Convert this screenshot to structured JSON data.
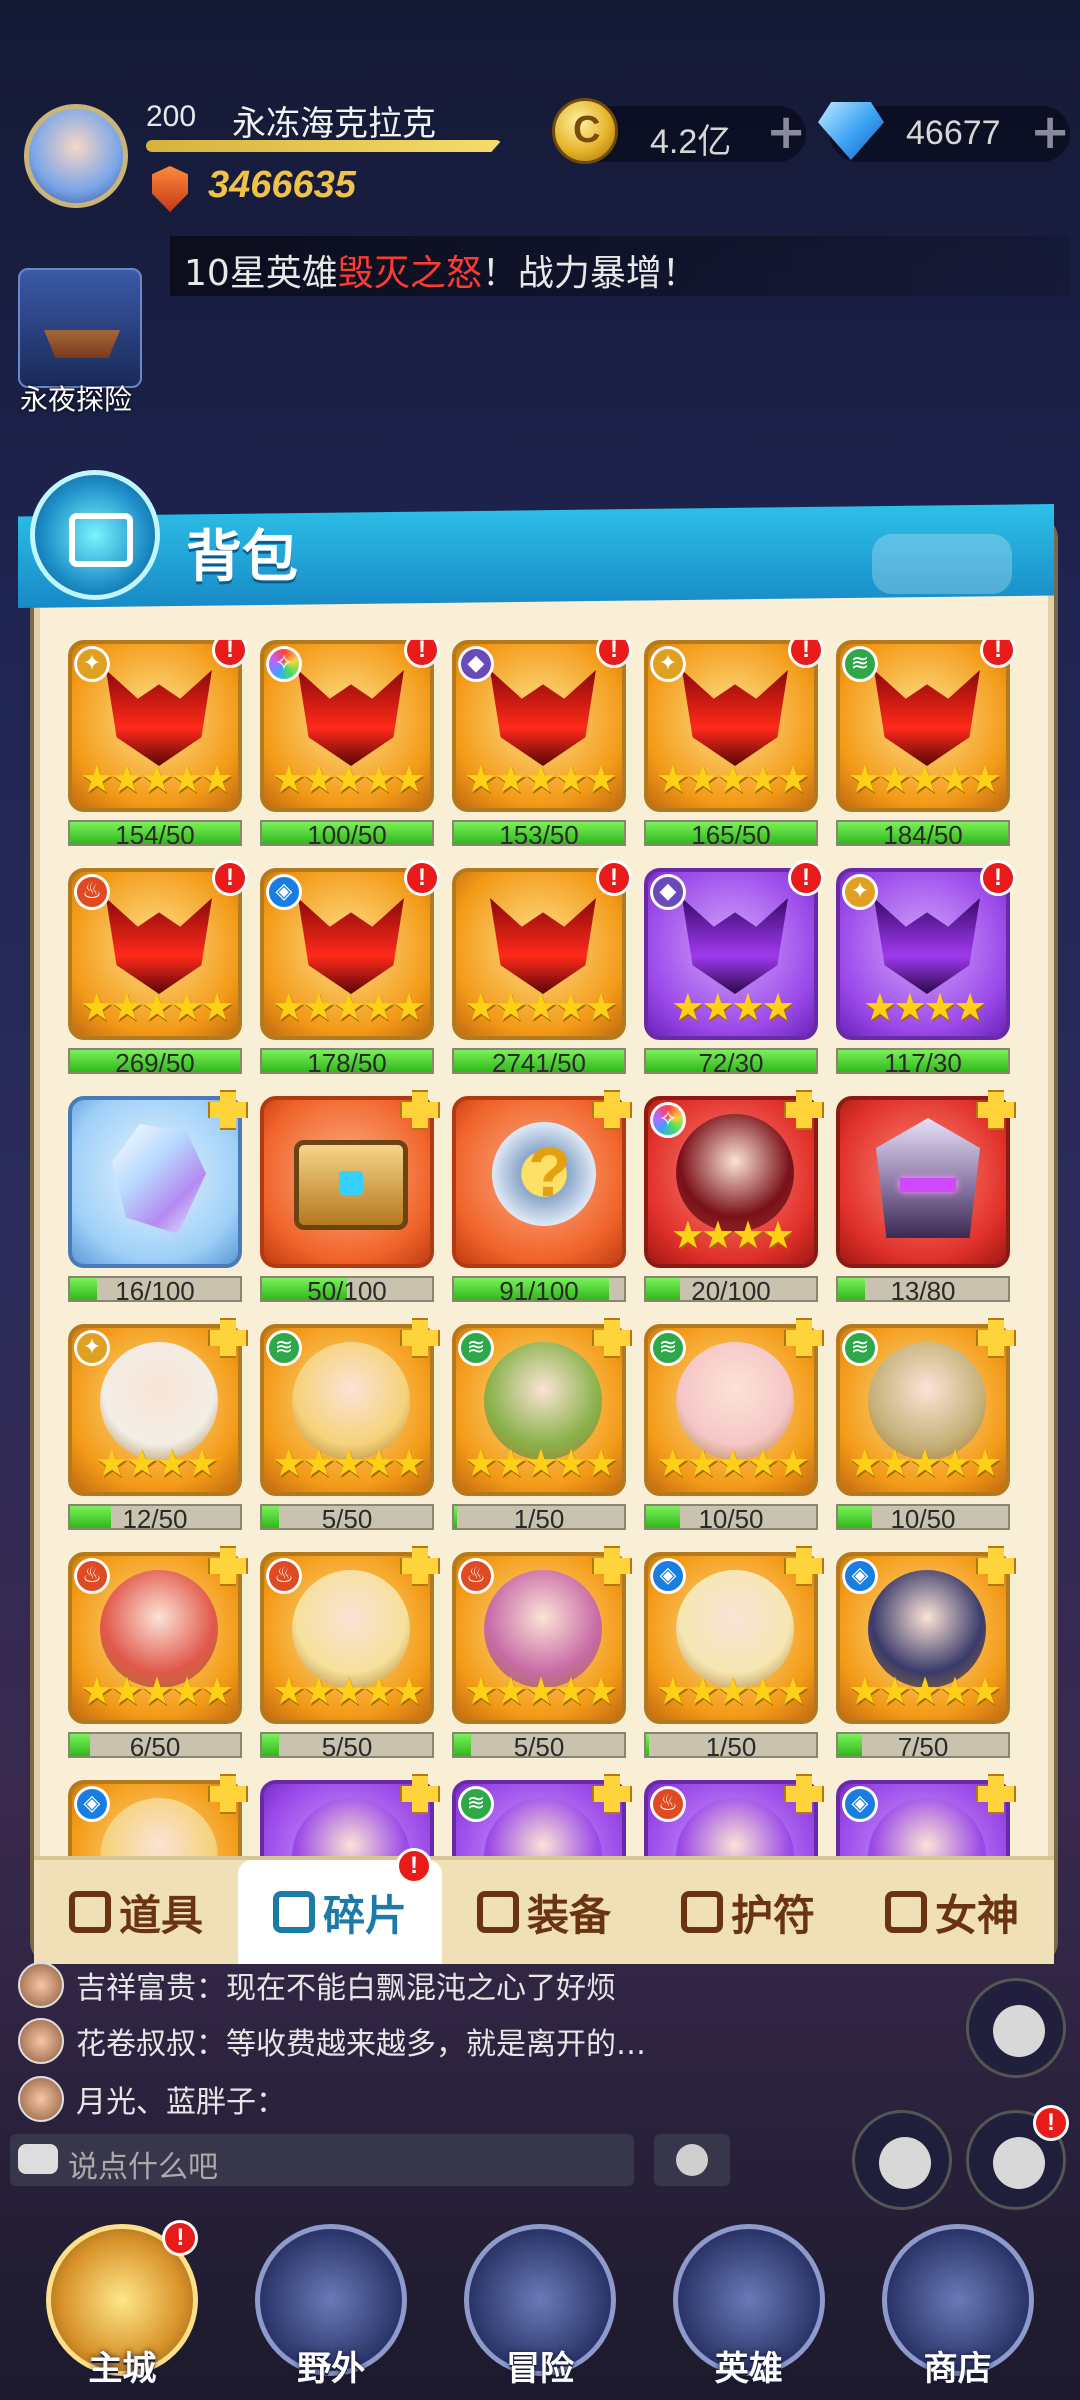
{
  "player": {
    "level": "200",
    "name": "永冻海克拉克",
    "power": "3466635"
  },
  "resources": {
    "gold": "4.2亿",
    "gems": "46677",
    "plus": "+"
  },
  "news": {
    "prefix": "10星英雄",
    "highlight": "毁灭之怒",
    "suffix": "！战力暴增！"
  },
  "side_event": {
    "label": "永夜探险"
  },
  "bag": {
    "title": "背包"
  },
  "items": [
    {
      "icon": "mask",
      "frame": "gold",
      "element": "light",
      "stars": "★★★★★",
      "progress": "154/50",
      "fill": 1.0,
      "badge": "alert"
    },
    {
      "icon": "mask",
      "frame": "gold",
      "element": "rainbow",
      "stars": "★★★★★",
      "progress": "100/50",
      "fill": 1.0,
      "badge": "alert"
    },
    {
      "icon": "mask",
      "frame": "gold",
      "element": "dark",
      "stars": "★★★★★",
      "progress": "153/50",
      "fill": 1.0,
      "badge": "alert"
    },
    {
      "icon": "mask",
      "frame": "gold",
      "element": "light",
      "stars": "★★★★★",
      "progress": "165/50",
      "fill": 1.0,
      "badge": "alert"
    },
    {
      "icon": "mask",
      "frame": "gold",
      "element": "nature",
      "stars": "★★★★★",
      "progress": "184/50",
      "fill": 1.0,
      "badge": "alert"
    },
    {
      "icon": "mask",
      "frame": "gold",
      "element": "fire",
      "stars": "★★★★★",
      "progress": "269/50",
      "fill": 1.0,
      "badge": "alert"
    },
    {
      "icon": "mask",
      "frame": "gold",
      "element": "water",
      "stars": "★★★★★",
      "progress": "178/50",
      "fill": 1.0,
      "badge": "alert"
    },
    {
      "icon": "mask",
      "frame": "gold",
      "element": "none",
      "stars": "★★★★★",
      "progress": "2741/50",
      "fill": 1.0,
      "badge": "alert"
    },
    {
      "icon": "mask-purple",
      "frame": "purple",
      "element": "dark",
      "stars": "★★★★",
      "progress": "72/30",
      "fill": 1.0,
      "badge": "alert"
    },
    {
      "icon": "mask-purple",
      "frame": "purple",
      "element": "light",
      "stars": "★★★★",
      "progress": "117/30",
      "fill": 1.0,
      "badge": "alert"
    },
    {
      "icon": "crystal",
      "frame": "blue",
      "element": "none",
      "stars": "",
      "progress": "16/100",
      "fill": 0.16,
      "badge": "piece"
    },
    {
      "icon": "chest",
      "frame": "orange",
      "element": "none",
      "stars": "",
      "progress": "50/100",
      "fill": 0.5,
      "badge": "piece"
    },
    {
      "icon": "qmark",
      "frame": "orange",
      "element": "none",
      "stars": "",
      "progress": "91/100",
      "fill": 0.91,
      "badge": "piece"
    },
    {
      "icon": "portrait",
      "frame": "red",
      "element": "rainbow",
      "stars": "★★★★",
      "progress": "20/100",
      "fill": 0.2,
      "badge": "piece",
      "color": "#7a1018"
    },
    {
      "icon": "helm",
      "frame": "red",
      "element": "none",
      "stars": "",
      "progress": "13/80",
      "fill": 0.16,
      "badge": "piece"
    },
    {
      "icon": "portrait",
      "frame": "gold",
      "element": "light",
      "stars": "★★★★",
      "progress": "12/50",
      "fill": 0.24,
      "badge": "piece",
      "color": "#f2eee6"
    },
    {
      "icon": "portrait",
      "frame": "gold",
      "element": "nature",
      "stars": "★★★★★",
      "progress": "5/50",
      "fill": 0.1,
      "badge": "piece",
      "color": "#f6d27a"
    },
    {
      "icon": "portrait",
      "frame": "gold",
      "element": "nature",
      "stars": "★★★★★",
      "progress": "1/50",
      "fill": 0.02,
      "badge": "piece",
      "color": "#8ab24a"
    },
    {
      "icon": "portrait",
      "frame": "gold",
      "element": "nature",
      "stars": "★★★★★",
      "progress": "10/50",
      "fill": 0.2,
      "badge": "piece",
      "color": "#f6c6c6"
    },
    {
      "icon": "portrait",
      "frame": "gold",
      "element": "nature",
      "stars": "★★★★★",
      "progress": "10/50",
      "fill": 0.2,
      "badge": "piece",
      "color": "#c6b27a"
    },
    {
      "icon": "portrait",
      "frame": "gold",
      "element": "fire",
      "stars": "★★★★★",
      "progress": "6/50",
      "fill": 0.12,
      "badge": "piece",
      "color": "#e0584a"
    },
    {
      "icon": "portrait",
      "frame": "gold",
      "element": "fire",
      "stars": "★★★★★",
      "progress": "5/50",
      "fill": 0.1,
      "badge": "piece",
      "color": "#f6e09a"
    },
    {
      "icon": "portrait",
      "frame": "gold",
      "element": "fire",
      "stars": "★★★★★",
      "progress": "5/50",
      "fill": 0.1,
      "badge": "piece",
      "color": "#c86aa6"
    },
    {
      "icon": "portrait",
      "frame": "gold",
      "element": "water",
      "stars": "★★★★★",
      "progress": "1/50",
      "fill": 0.02,
      "badge": "piece",
      "color": "#f6e6b2"
    },
    {
      "icon": "portrait",
      "frame": "gold",
      "element": "water",
      "stars": "★★★★★",
      "progress": "7/50",
      "fill": 0.14,
      "badge": "piece",
      "color": "#3a3a6a"
    },
    {
      "icon": "portrait",
      "frame": "gold",
      "element": "water",
      "stars": "",
      "progress": "",
      "fill": 0,
      "badge": "piece",
      "color": "#f6d27a"
    },
    {
      "icon": "portrait",
      "frame": "purple",
      "element": "none",
      "stars": "",
      "progress": "",
      "fill": 0,
      "badge": "piece",
      "color": "#9a48e8"
    },
    {
      "icon": "portrait",
      "frame": "purple",
      "element": "nature",
      "stars": "",
      "progress": "",
      "fill": 0,
      "badge": "piece",
      "color": "#9a48e8"
    },
    {
      "icon": "portrait",
      "frame": "purple",
      "element": "fire",
      "stars": "",
      "progress": "",
      "fill": 0,
      "badge": "piece",
      "color": "#9a48e8"
    },
    {
      "icon": "portrait",
      "frame": "purple",
      "element": "water",
      "stars": "",
      "progress": "",
      "fill": 0,
      "badge": "piece",
      "color": "#9a48e8"
    }
  ],
  "element_glyphs": {
    "light": "✦",
    "nature": "≋",
    "dark": "◆",
    "fire": "♨",
    "water": "◈",
    "rainbow": "✧"
  },
  "tabs": [
    {
      "label": "道具",
      "active": false
    },
    {
      "label": "碎片",
      "active": true,
      "alert": "!"
    },
    {
      "label": "装备",
      "active": false
    },
    {
      "label": "护符",
      "active": false
    },
    {
      "label": "女神",
      "active": false
    }
  ],
  "chat": {
    "messages": [
      {
        "sender": "吉祥富贵",
        "text": "现在不能白飘混沌之心了好烦"
      },
      {
        "sender": "花卷叔叔",
        "text": "等收费越来越多，就是离开的…"
      },
      {
        "sender": "月光、蓝胖子",
        "text": ""
      }
    ],
    "placeholder": "说点什么吧"
  },
  "nav": [
    {
      "label": "主城",
      "alert": "!"
    },
    {
      "label": "野外"
    },
    {
      "label": "冒险"
    },
    {
      "label": "英雄"
    },
    {
      "label": "商店"
    }
  ],
  "alert_mark": "!"
}
